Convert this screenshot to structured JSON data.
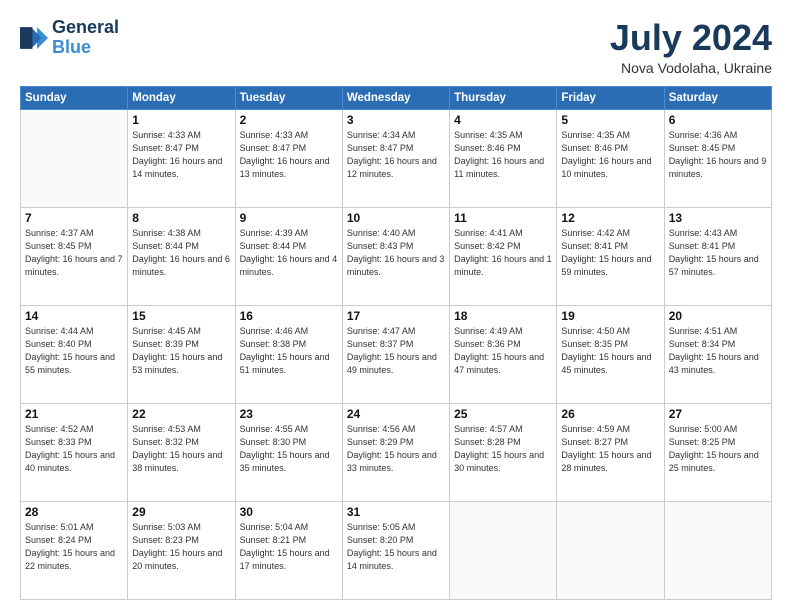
{
  "header": {
    "logo_line1": "General",
    "logo_line2": "Blue",
    "month": "July 2024",
    "location": "Nova Vodolaha, Ukraine"
  },
  "weekdays": [
    "Sunday",
    "Monday",
    "Tuesday",
    "Wednesday",
    "Thursday",
    "Friday",
    "Saturday"
  ],
  "weeks": [
    [
      {
        "day": "",
        "info": ""
      },
      {
        "day": "1",
        "info": "Sunrise: 4:33 AM\nSunset: 8:47 PM\nDaylight: 16 hours\nand 14 minutes."
      },
      {
        "day": "2",
        "info": "Sunrise: 4:33 AM\nSunset: 8:47 PM\nDaylight: 16 hours\nand 13 minutes."
      },
      {
        "day": "3",
        "info": "Sunrise: 4:34 AM\nSunset: 8:47 PM\nDaylight: 16 hours\nand 12 minutes."
      },
      {
        "day": "4",
        "info": "Sunrise: 4:35 AM\nSunset: 8:46 PM\nDaylight: 16 hours\nand 11 minutes."
      },
      {
        "day": "5",
        "info": "Sunrise: 4:35 AM\nSunset: 8:46 PM\nDaylight: 16 hours\nand 10 minutes."
      },
      {
        "day": "6",
        "info": "Sunrise: 4:36 AM\nSunset: 8:45 PM\nDaylight: 16 hours\nand 9 minutes."
      }
    ],
    [
      {
        "day": "7",
        "info": "Sunrise: 4:37 AM\nSunset: 8:45 PM\nDaylight: 16 hours\nand 7 minutes."
      },
      {
        "day": "8",
        "info": "Sunrise: 4:38 AM\nSunset: 8:44 PM\nDaylight: 16 hours\nand 6 minutes."
      },
      {
        "day": "9",
        "info": "Sunrise: 4:39 AM\nSunset: 8:44 PM\nDaylight: 16 hours\nand 4 minutes."
      },
      {
        "day": "10",
        "info": "Sunrise: 4:40 AM\nSunset: 8:43 PM\nDaylight: 16 hours\nand 3 minutes."
      },
      {
        "day": "11",
        "info": "Sunrise: 4:41 AM\nSunset: 8:42 PM\nDaylight: 16 hours\nand 1 minute."
      },
      {
        "day": "12",
        "info": "Sunrise: 4:42 AM\nSunset: 8:41 PM\nDaylight: 15 hours\nand 59 minutes."
      },
      {
        "day": "13",
        "info": "Sunrise: 4:43 AM\nSunset: 8:41 PM\nDaylight: 15 hours\nand 57 minutes."
      }
    ],
    [
      {
        "day": "14",
        "info": "Sunrise: 4:44 AM\nSunset: 8:40 PM\nDaylight: 15 hours\nand 55 minutes."
      },
      {
        "day": "15",
        "info": "Sunrise: 4:45 AM\nSunset: 8:39 PM\nDaylight: 15 hours\nand 53 minutes."
      },
      {
        "day": "16",
        "info": "Sunrise: 4:46 AM\nSunset: 8:38 PM\nDaylight: 15 hours\nand 51 minutes."
      },
      {
        "day": "17",
        "info": "Sunrise: 4:47 AM\nSunset: 8:37 PM\nDaylight: 15 hours\nand 49 minutes."
      },
      {
        "day": "18",
        "info": "Sunrise: 4:49 AM\nSunset: 8:36 PM\nDaylight: 15 hours\nand 47 minutes."
      },
      {
        "day": "19",
        "info": "Sunrise: 4:50 AM\nSunset: 8:35 PM\nDaylight: 15 hours\nand 45 minutes."
      },
      {
        "day": "20",
        "info": "Sunrise: 4:51 AM\nSunset: 8:34 PM\nDaylight: 15 hours\nand 43 minutes."
      }
    ],
    [
      {
        "day": "21",
        "info": "Sunrise: 4:52 AM\nSunset: 8:33 PM\nDaylight: 15 hours\nand 40 minutes."
      },
      {
        "day": "22",
        "info": "Sunrise: 4:53 AM\nSunset: 8:32 PM\nDaylight: 15 hours\nand 38 minutes."
      },
      {
        "day": "23",
        "info": "Sunrise: 4:55 AM\nSunset: 8:30 PM\nDaylight: 15 hours\nand 35 minutes."
      },
      {
        "day": "24",
        "info": "Sunrise: 4:56 AM\nSunset: 8:29 PM\nDaylight: 15 hours\nand 33 minutes."
      },
      {
        "day": "25",
        "info": "Sunrise: 4:57 AM\nSunset: 8:28 PM\nDaylight: 15 hours\nand 30 minutes."
      },
      {
        "day": "26",
        "info": "Sunrise: 4:59 AM\nSunset: 8:27 PM\nDaylight: 15 hours\nand 28 minutes."
      },
      {
        "day": "27",
        "info": "Sunrise: 5:00 AM\nSunset: 8:25 PM\nDaylight: 15 hours\nand 25 minutes."
      }
    ],
    [
      {
        "day": "28",
        "info": "Sunrise: 5:01 AM\nSunset: 8:24 PM\nDaylight: 15 hours\nand 22 minutes."
      },
      {
        "day": "29",
        "info": "Sunrise: 5:03 AM\nSunset: 8:23 PM\nDaylight: 15 hours\nand 20 minutes."
      },
      {
        "day": "30",
        "info": "Sunrise: 5:04 AM\nSunset: 8:21 PM\nDaylight: 15 hours\nand 17 minutes."
      },
      {
        "day": "31",
        "info": "Sunrise: 5:05 AM\nSunset: 8:20 PM\nDaylight: 15 hours\nand 14 minutes."
      },
      {
        "day": "",
        "info": ""
      },
      {
        "day": "",
        "info": ""
      },
      {
        "day": "",
        "info": ""
      }
    ]
  ]
}
